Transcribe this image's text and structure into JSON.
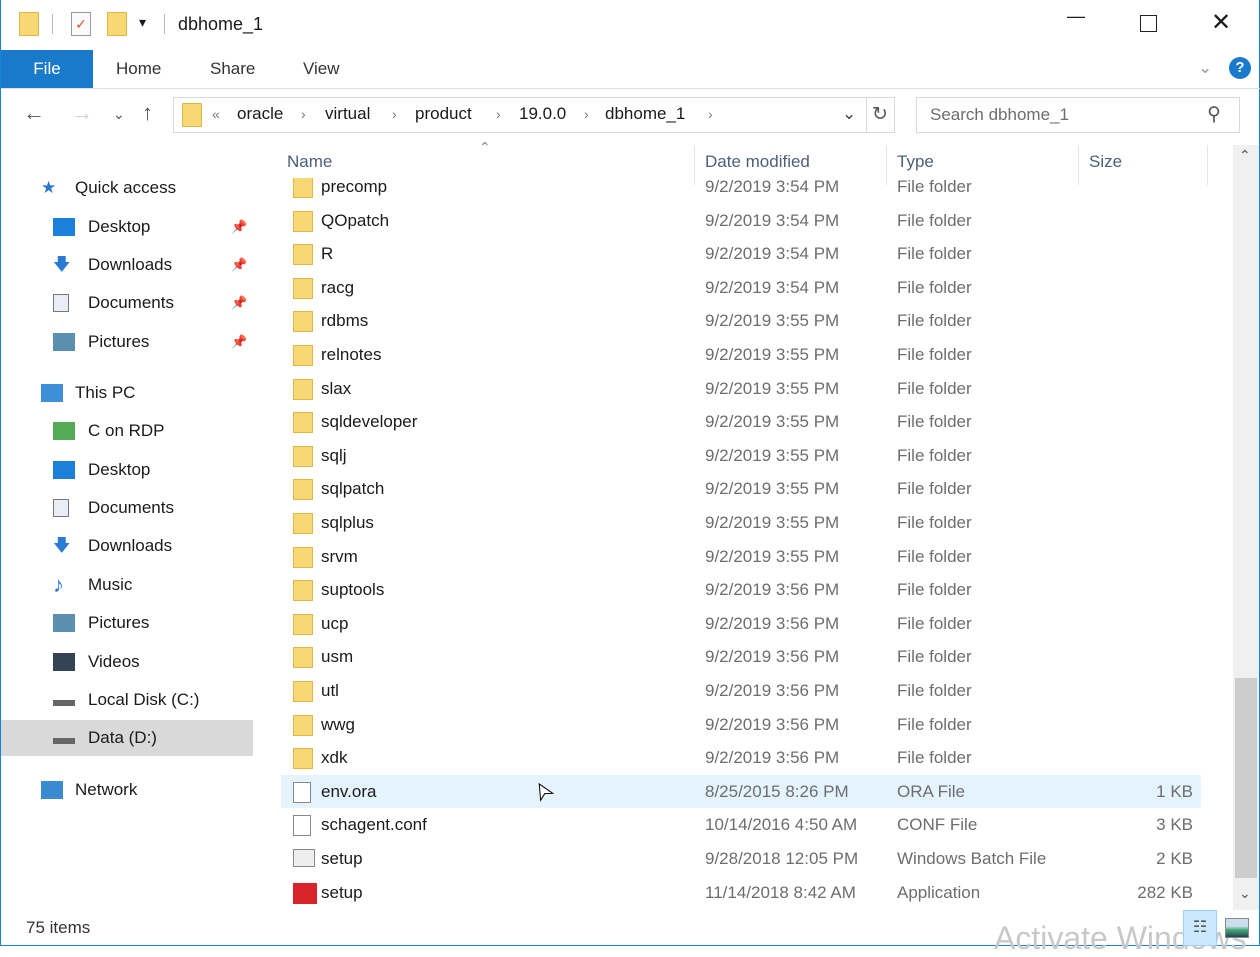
{
  "window": {
    "title": "dbhome_1"
  },
  "ribbon": {
    "tabs": [
      "File",
      "Home",
      "Share",
      "View"
    ]
  },
  "address": {
    "overflow": "«",
    "crumbs": [
      "oracle",
      "virtual",
      "product",
      "19.0.0",
      "dbhome_1"
    ],
    "search_placeholder": "Search dbhome_1"
  },
  "nav": [
    {
      "label": "Quick access",
      "icon": "star-icon",
      "top": true
    },
    {
      "label": "Desktop",
      "icon": "desktop-icon",
      "pinned": true
    },
    {
      "label": "Downloads",
      "icon": "download-icon",
      "pinned": true
    },
    {
      "label": "Documents",
      "icon": "document-icon",
      "pinned": true
    },
    {
      "label": "Pictures",
      "icon": "pictures-icon",
      "pinned": true
    },
    {
      "label": "This PC",
      "icon": "computer-icon",
      "top": true
    },
    {
      "label": "C on RDP",
      "icon": "network-drive-icon"
    },
    {
      "label": "Desktop",
      "icon": "desktop-icon"
    },
    {
      "label": "Documents",
      "icon": "document-icon"
    },
    {
      "label": "Downloads",
      "icon": "download-icon"
    },
    {
      "label": "Music",
      "icon": "music-icon"
    },
    {
      "label": "Pictures",
      "icon": "pictures-icon"
    },
    {
      "label": "Videos",
      "icon": "videos-icon"
    },
    {
      "label": "Local Disk (C:)",
      "icon": "disk-icon"
    },
    {
      "label": "Data (D:)",
      "icon": "disk-icon",
      "selected": true
    },
    {
      "label": "Network",
      "icon": "network-icon",
      "top": true
    }
  ],
  "columns": {
    "name": "Name",
    "date": "Date modified",
    "type": "Type",
    "size": "Size"
  },
  "files": [
    {
      "name": "precomp",
      "date": "9/2/2019 3:54 PM",
      "type": "File folder",
      "size": "",
      "kind": "folder"
    },
    {
      "name": "QOpatch",
      "date": "9/2/2019 3:54 PM",
      "type": "File folder",
      "size": "",
      "kind": "folder"
    },
    {
      "name": "R",
      "date": "9/2/2019 3:54 PM",
      "type": "File folder",
      "size": "",
      "kind": "folder"
    },
    {
      "name": "racg",
      "date": "9/2/2019 3:54 PM",
      "type": "File folder",
      "size": "",
      "kind": "folder"
    },
    {
      "name": "rdbms",
      "date": "9/2/2019 3:55 PM",
      "type": "File folder",
      "size": "",
      "kind": "folder"
    },
    {
      "name": "relnotes",
      "date": "9/2/2019 3:55 PM",
      "type": "File folder",
      "size": "",
      "kind": "folder"
    },
    {
      "name": "slax",
      "date": "9/2/2019 3:55 PM",
      "type": "File folder",
      "size": "",
      "kind": "folder"
    },
    {
      "name": "sqldeveloper",
      "date": "9/2/2019 3:55 PM",
      "type": "File folder",
      "size": "",
      "kind": "folder"
    },
    {
      "name": "sqlj",
      "date": "9/2/2019 3:55 PM",
      "type": "File folder",
      "size": "",
      "kind": "folder"
    },
    {
      "name": "sqlpatch",
      "date": "9/2/2019 3:55 PM",
      "type": "File folder",
      "size": "",
      "kind": "folder"
    },
    {
      "name": "sqlplus",
      "date": "9/2/2019 3:55 PM",
      "type": "File folder",
      "size": "",
      "kind": "folder"
    },
    {
      "name": "srvm",
      "date": "9/2/2019 3:55 PM",
      "type": "File folder",
      "size": "",
      "kind": "folder"
    },
    {
      "name": "suptools",
      "date": "9/2/2019 3:56 PM",
      "type": "File folder",
      "size": "",
      "kind": "folder"
    },
    {
      "name": "ucp",
      "date": "9/2/2019 3:56 PM",
      "type": "File folder",
      "size": "",
      "kind": "folder"
    },
    {
      "name": "usm",
      "date": "9/2/2019 3:56 PM",
      "type": "File folder",
      "size": "",
      "kind": "folder"
    },
    {
      "name": "utl",
      "date": "9/2/2019 3:56 PM",
      "type": "File folder",
      "size": "",
      "kind": "folder"
    },
    {
      "name": "wwg",
      "date": "9/2/2019 3:56 PM",
      "type": "File folder",
      "size": "",
      "kind": "folder"
    },
    {
      "name": "xdk",
      "date": "9/2/2019 3:56 PM",
      "type": "File folder",
      "size": "",
      "kind": "folder"
    },
    {
      "name": "env.ora",
      "date": "8/25/2015 8:26 PM",
      "type": "ORA File",
      "size": "1 KB",
      "kind": "file",
      "hover": true
    },
    {
      "name": "schagent.conf",
      "date": "10/14/2016 4:50 AM",
      "type": "CONF File",
      "size": "3 KB",
      "kind": "file"
    },
    {
      "name": "setup",
      "date": "9/28/2018 12:05 PM",
      "type": "Windows Batch File",
      "size": "2 KB",
      "kind": "batch"
    },
    {
      "name": "setup",
      "date": "11/14/2018 8:42 AM",
      "type": "Application",
      "size": "282 KB",
      "kind": "app"
    }
  ],
  "status": {
    "count": "75 items"
  },
  "watermark": "Activate Windows",
  "colors": {
    "accent": "#1979ca",
    "hover": "#e5f3ff",
    "selected": "#d9d9d9"
  }
}
